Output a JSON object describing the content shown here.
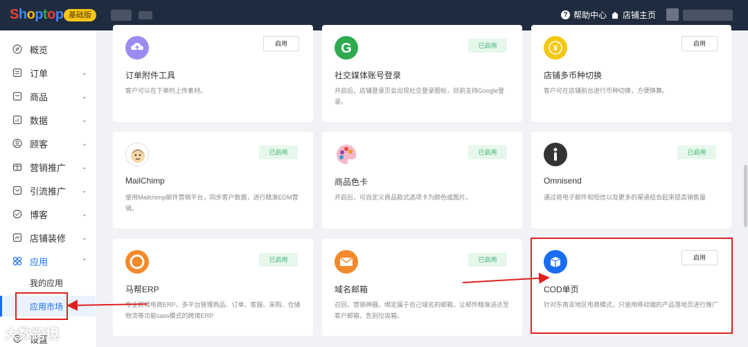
{
  "header": {
    "logo": [
      "S",
      "h",
      "o",
      "p",
      "t",
      "o",
      "p"
    ],
    "logo_colors": [
      "#ea4335",
      "#4285f4",
      "#fbbc05",
      "#4285f4",
      "#34a853",
      "#ea4335",
      "#4285f4"
    ],
    "badge": "基础版",
    "help": "帮助中心",
    "store": "店铺主页"
  },
  "sidebar": {
    "items": [
      {
        "label": "概览",
        "icon": "compass-icon"
      },
      {
        "label": "订单",
        "icon": "order-icon"
      },
      {
        "label": "商品",
        "icon": "product-icon"
      },
      {
        "label": "数据",
        "icon": "chart-icon"
      },
      {
        "label": "顾客",
        "icon": "user-icon"
      },
      {
        "label": "营销推广",
        "icon": "marketing-icon"
      },
      {
        "label": "引流推广",
        "icon": "traffic-icon"
      },
      {
        "label": "博客",
        "icon": "blog-icon"
      },
      {
        "label": "店铺装修",
        "icon": "decoration-icon"
      },
      {
        "label": "应用",
        "icon": "apps-icon"
      }
    ],
    "sub_items": [
      "我的应用",
      "应用市场"
    ],
    "last_item": "设置"
  },
  "cards": [
    {
      "title": "订单附件工具",
      "desc": "客户可以在下单时上传素材。",
      "status": "启用",
      "enabled": false,
      "icon": "upload-icon",
      "color": "#9a8cf0"
    },
    {
      "title": "社交媒体账号登录",
      "desc": "开启后，店铺登录页会出现社交登录图标，目前支持Google登录。",
      "status": "已启用",
      "enabled": true,
      "icon": "google-icon",
      "color": "#2eaa4f"
    },
    {
      "title": "店铺多币种切换",
      "desc": "客户可在店铺前台进行币种切换，方便换算。",
      "status": "启用",
      "enabled": false,
      "icon": "currency-icon",
      "color": "#f2c811"
    },
    {
      "title": "MailChimp",
      "desc": "使用Mailchimp邮件营销平台，同步客户数据，进行精准EDM营销。",
      "status": "已启用",
      "enabled": true,
      "icon": "mailchimp-icon",
      "color": "#ffffff"
    },
    {
      "title": "商品色卡",
      "desc": "开启后，可自定义商品款式选项卡为颜色或图片。",
      "status": "已启用",
      "enabled": true,
      "icon": "palette-icon",
      "color": "#ffffff"
    },
    {
      "title": "Omnisend",
      "desc": "通过将电子邮件和短信以及更多的渠道结合起来提高销售量",
      "status": "已启用",
      "enabled": true,
      "icon": "omnisend-icon",
      "color": "#333333"
    },
    {
      "title": "马帮ERP",
      "desc": "专业跨境电商ERP。多平台管理商品、订单、客服、采购、仓储物流等功能sass模式的跨境ERP",
      "status": "已启用",
      "enabled": true,
      "icon": "mabang-icon",
      "color": "#f28a2c"
    },
    {
      "title": "域名邮箱",
      "desc": "召回，营销神器。绑定属于自己域名的邮箱，让邮件精准送达至客户邮箱，告别垃圾箱。",
      "status": "已启用",
      "enabled": true,
      "icon": "mail-icon",
      "color": "#f28a2c"
    },
    {
      "title": "COD单页",
      "desc": "针对东南亚地区电商模式，只使用移动端的产品落地页进行推广",
      "status": "启用",
      "enabled": false,
      "icon": "box-icon",
      "color": "#1a6df3"
    }
  ],
  "watermark": "大数跨境"
}
